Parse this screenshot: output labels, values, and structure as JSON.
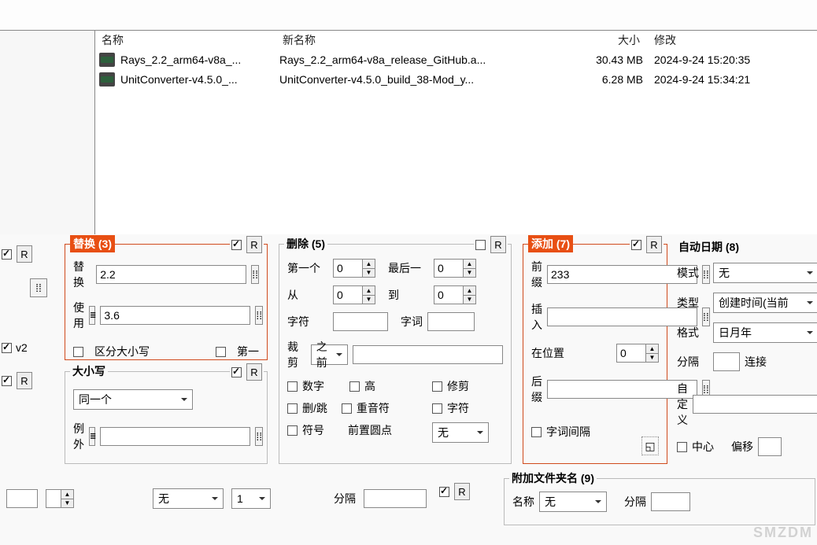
{
  "file_list": {
    "headers": {
      "name": "名称",
      "newname": "新名称",
      "size": "大小",
      "mod": "修改"
    },
    "rows": [
      {
        "name": "Rays_2.2_arm64-v8a_...",
        "newname": "Rays_2.2_arm64-v8a_release_GitHub.a...",
        "size": "30.43 MB",
        "mod": "2024-9-24 15:20:35"
      },
      {
        "name": "UnitConverter-v4.5.0_...",
        "newname": "UnitConverter-v4.5.0_build_38-Mod_y...",
        "size": "6.28 MB",
        "mod": "2024-9-24 15:34:21"
      }
    ]
  },
  "left_strip": {
    "r": "R",
    "v2": "v2"
  },
  "replace": {
    "title": "替换 (3)",
    "r": "R",
    "lbl_replace": "替换",
    "val_replace": "2.2",
    "lbl_with": "使用",
    "val_with": "3.6",
    "match_case": "区分大小写",
    "first": "第一"
  },
  "case_sect": {
    "title": "大小写",
    "r": "R",
    "same": "同一个",
    "except": "例外"
  },
  "remove": {
    "title": "删除 (5)",
    "r": "R",
    "first_n": "第一个",
    "first_n_v": "0",
    "last_n": "最后一",
    "last_n_v": "0",
    "from": "从",
    "from_v": "0",
    "to": "到",
    "to_v": "0",
    "chars": "字符",
    "words": "字词",
    "crop": "裁剪",
    "before": "之前",
    "digits": "数字",
    "high": "高",
    "trim": "修剪",
    "ds": "删/跳",
    "accents": "重音符",
    "chars2": "字符",
    "sym": "符号",
    "lead_dots": "前置圆点",
    "none": "无"
  },
  "add": {
    "title": "添加 (7)",
    "r": "R",
    "prefix": "前缀",
    "prefix_v": "233",
    "insert": "插入",
    "at_pos": "在位置",
    "at_pos_v": "0",
    "suffix": "后缀",
    "word_space": "字词间隔"
  },
  "autodate": {
    "title": "自动日期 (8)",
    "mode": "模式",
    "mode_v": "无",
    "type": "类型",
    "type_v": "创建时间(当前",
    "fmt": "格式",
    "fmt_v": "日月年",
    "sep": "分隔",
    "conn": "连接",
    "custom": "自定义",
    "cent": "中心",
    "offset": "偏移"
  },
  "bottom_bar": {
    "none": "无",
    "one": "1",
    "sep": "分隔",
    "r": "R"
  },
  "append_folder": {
    "title": "附加文件夹名 (9)",
    "name": "名称",
    "none": "无",
    "sep": "分隔"
  },
  "watermark": "SMZDM"
}
